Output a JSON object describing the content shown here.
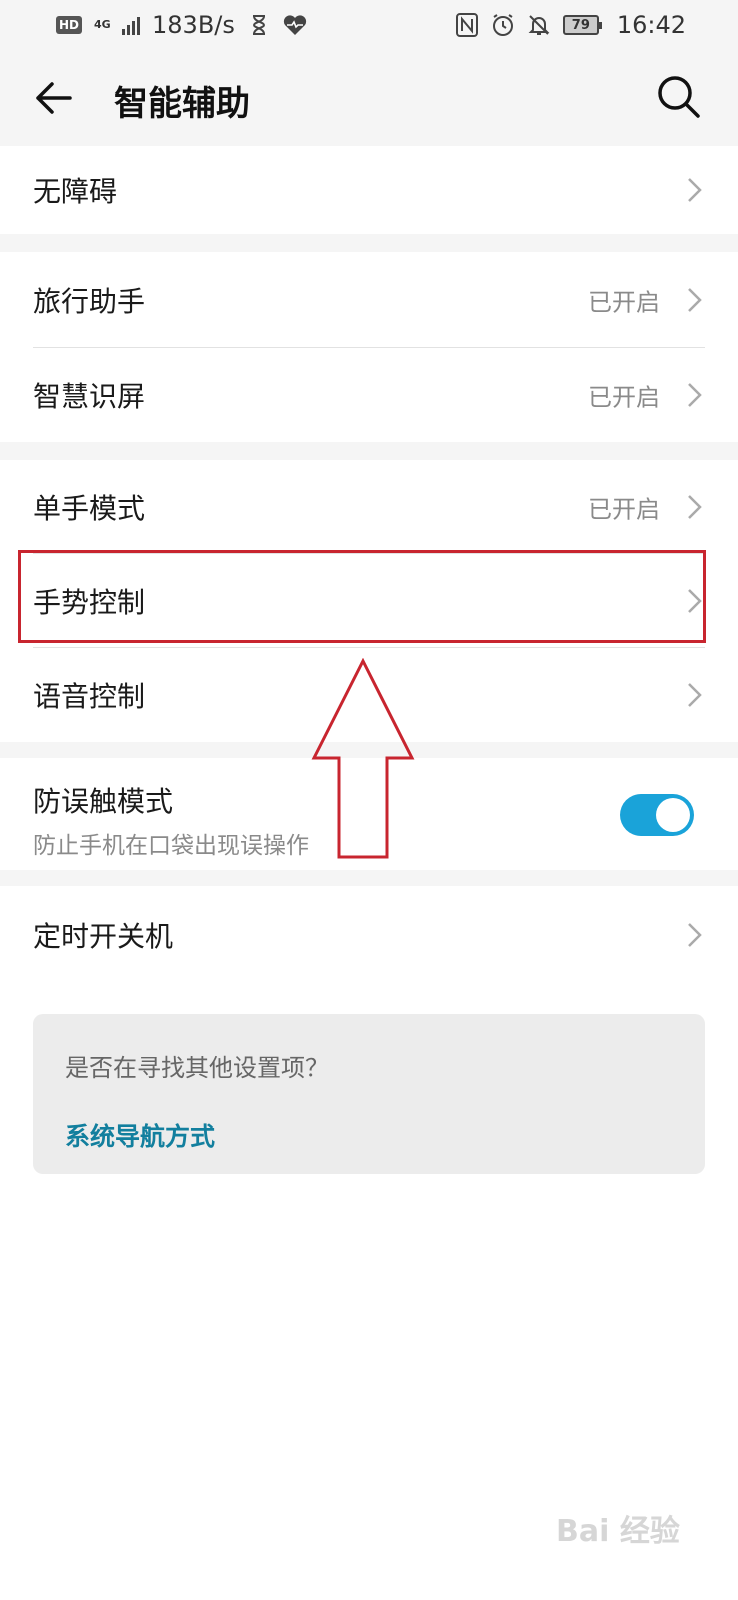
{
  "status_bar": {
    "hd": "HD",
    "network": "4G",
    "speed": "183B/s",
    "battery": "79",
    "time": "16:42",
    "icons": [
      "hourglass-icon",
      "heart-rate-icon",
      "nfc-icon",
      "alarm-icon",
      "mute-icon"
    ]
  },
  "header": {
    "title": "智能辅助",
    "back_icon": "arrow-left-icon",
    "search_icon": "search-icon"
  },
  "groups": [
    {
      "items": [
        {
          "label": "无障碍",
          "status": ""
        }
      ]
    },
    {
      "items": [
        {
          "label": "旅行助手",
          "status": "已开启"
        },
        {
          "label": "智慧识屏",
          "status": "已开启"
        }
      ]
    },
    {
      "items": [
        {
          "label": "单手模式",
          "status": "已开启"
        },
        {
          "label": "手势控制",
          "status": ""
        },
        {
          "label": "语音控制",
          "status": ""
        }
      ]
    },
    {
      "toggle": {
        "label": "防误触模式",
        "subtitle": "防止手机在口袋出现误操作",
        "on": true
      }
    },
    {
      "items": [
        {
          "label": "定时开关机",
          "status": ""
        }
      ]
    }
  ],
  "suggestion": {
    "question": "是否在寻找其他设置项？",
    "link": "系统导航方式"
  },
  "watermark": "Bai 经验",
  "colors": {
    "accent": "#1aa3d9",
    "link": "#127f9e",
    "highlight": "#c8252f"
  }
}
